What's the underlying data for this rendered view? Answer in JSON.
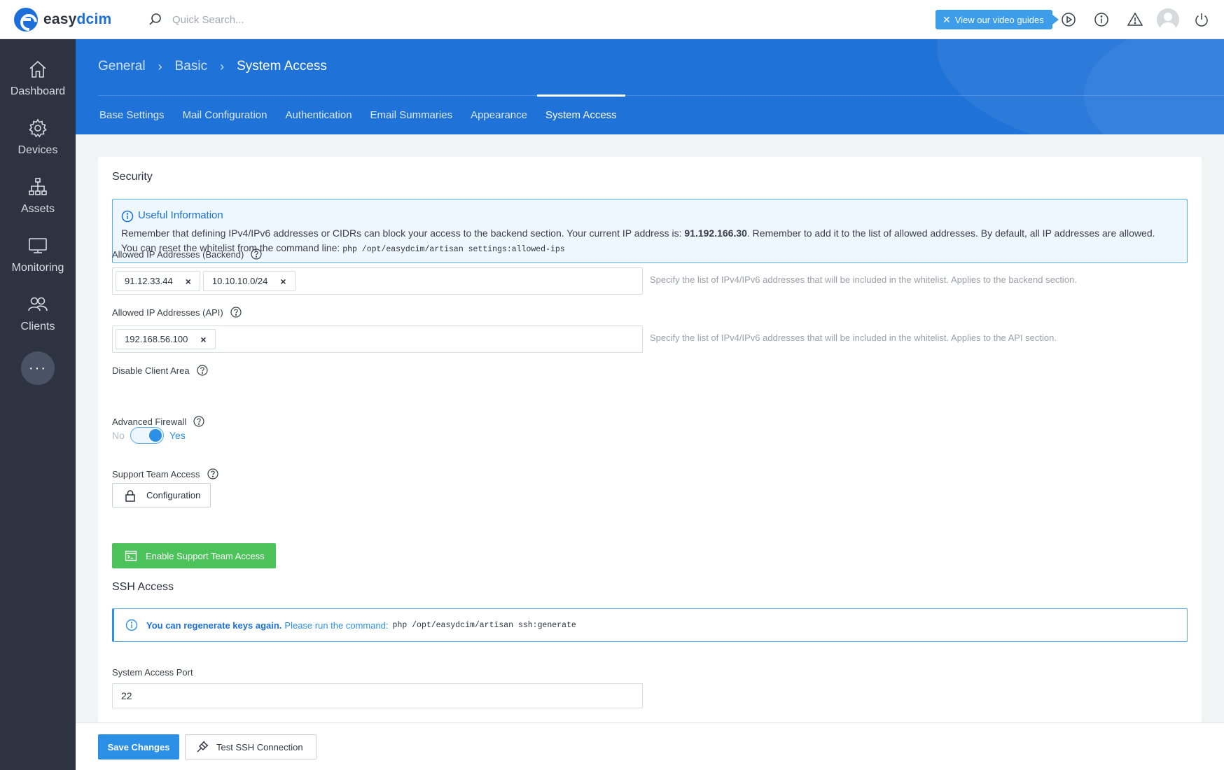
{
  "app": {
    "logo_prefix": "easy",
    "logo_suffix": "dcim"
  },
  "search": {
    "placeholder": "Quick Search..."
  },
  "topbar": {
    "video_label": "View our video guides"
  },
  "sidebar": {
    "items": [
      {
        "label": "Dashboard",
        "icon": "home-icon"
      },
      {
        "label": "Devices",
        "icon": "gear-icon"
      },
      {
        "label": "Assets",
        "icon": "hierarchy-icon"
      },
      {
        "label": "Monitoring",
        "icon": "monitor-icon"
      },
      {
        "label": "Clients",
        "icon": "users-icon"
      }
    ],
    "more_label": "···"
  },
  "breadcrumb": {
    "level1": "General",
    "level2": "Basic",
    "current": "System Access"
  },
  "tabs": [
    {
      "label": "Base Settings",
      "active": false
    },
    {
      "label": "Mail Configuration",
      "active": false
    },
    {
      "label": "Authentication",
      "active": false
    },
    {
      "label": "Email Summaries",
      "active": false
    },
    {
      "label": "Appearance",
      "active": false
    },
    {
      "label": "System Access",
      "active": true
    }
  ],
  "security": {
    "title": "Security",
    "info": {
      "title": "Useful Information",
      "line1_pre": "Remember that defining IPv4/IPv6 addresses or CIDRs can block your access to the backend section. Your current IP address is: ",
      "current_ip": "91.192.166.30",
      "line1_post": ". Remember to add it to the list of allowed addresses. By default, all IP addresses are allowed.",
      "line2_text": "You can reset the whitelist from the command line: ",
      "line2_command": "php /opt/easydcim/artisan settings:allowed-ips"
    },
    "backend_ips": {
      "label": "Allowed IP Addresses (Backend)",
      "tags": [
        "91.12.33.44",
        "10.10.10.0/24"
      ],
      "help": "Specify the list of IPv4/IPv6 addresses that will be included in the whitelist. Applies to the backend section."
    },
    "api_ips": {
      "label": "Allowed IP Addresses (API)",
      "tags": [
        "192.168.56.100"
      ],
      "help": "Specify the list of IPv4/IPv6 addresses that will be included in the whitelist. Applies to the API section."
    },
    "disable_client_area": {
      "label": "Disable Client Area",
      "off_label": "No",
      "on_label": "Yes",
      "value": true
    },
    "advanced_firewall": {
      "label": "Advanced Firewall",
      "button": "Configuration"
    },
    "support_team": {
      "label": "Support Team Access",
      "button": "Enable Support Team Access"
    }
  },
  "ssh": {
    "title": "SSH Access",
    "info_strong": "You can regenerate keys again.",
    "info_text": "Please run the command:",
    "info_command": "php /opt/easydcim/artisan ssh:generate",
    "port_label": "System Access Port",
    "port_value": "22"
  },
  "footer": {
    "save": "Save Changes",
    "test": "Test SSH Connection"
  },
  "colors": {
    "brand": "#1f73d8",
    "sidebar": "#2d3340",
    "accent": "#2b8fe6",
    "success": "#4cc35a"
  }
}
